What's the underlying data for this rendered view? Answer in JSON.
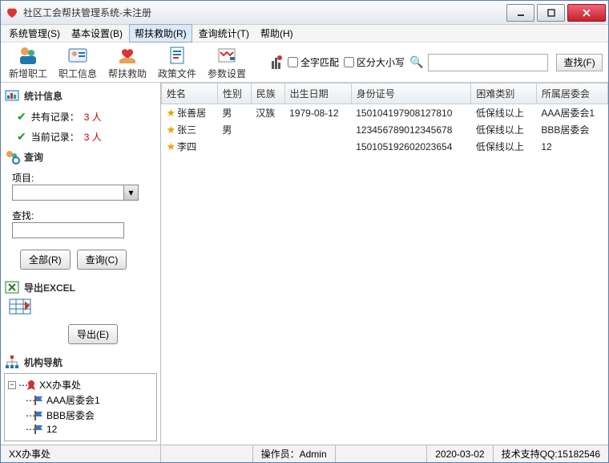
{
  "window": {
    "title": "社区工会帮扶管理系统-未注册"
  },
  "menu": {
    "items": [
      {
        "label": "系统管理(S)"
      },
      {
        "label": "基本设置(B)"
      },
      {
        "label": "帮扶救助(R)"
      },
      {
        "label": "查询统计(T)"
      },
      {
        "label": "帮助(H)"
      }
    ],
    "active_index": 2
  },
  "toolbar": {
    "buttons": [
      {
        "label": "新增职工",
        "name": "new-employee"
      },
      {
        "label": "职工信息",
        "name": "employee-info"
      },
      {
        "label": "帮扶救助",
        "name": "aid"
      },
      {
        "label": "政策文件",
        "name": "policy-docs"
      },
      {
        "label": "参数设置",
        "name": "params"
      }
    ],
    "config_icon": "wrench-icon",
    "full_match_label": "全字匹配",
    "case_sensitive_label": "区分大小写",
    "search_placeholder": "",
    "find_label": "查找(F)"
  },
  "sidebar": {
    "stats": {
      "title": "统计信息",
      "total_label": "共有记录：",
      "total_value": "3 人",
      "current_label": "当前记录：",
      "current_value": "3 人"
    },
    "query": {
      "title": "查询",
      "project_label": "项目:",
      "project_value": "",
      "search_label": "查找:",
      "search_value": "",
      "all_btn": "全部(R)",
      "query_btn": "查询(C)"
    },
    "export": {
      "title": "导出EXCEL",
      "btn": "导出(E)"
    },
    "nav": {
      "title": "机构导航",
      "root": "XX办事处",
      "children": [
        "AAA居委会1",
        "BBB居委会",
        "12"
      ]
    }
  },
  "table": {
    "columns": [
      "姓名",
      "性别",
      "民族",
      "出生日期",
      "身份证号",
      "困难类别",
      "所属居委会"
    ],
    "rows": [
      {
        "name": "张善居",
        "gender": "男",
        "ethnic": "汉族",
        "birth": "1979-08-12",
        "id": "150104197908127810",
        "category": "低保线以上",
        "committee": "AAA居委会1"
      },
      {
        "name": "张三",
        "gender": "男",
        "ethnic": "",
        "birth": "",
        "id": "123456789012345678",
        "category": "低保线以上",
        "committee": "BBB居委会"
      },
      {
        "name": "李四",
        "gender": "",
        "ethnic": "",
        "birth": "",
        "id": "150105192602023654",
        "category": "低保线以上",
        "committee": "12"
      }
    ]
  },
  "status": {
    "office": "XX办事处",
    "operator_label": "操作员：",
    "operator_value": "Admin",
    "date": "2020-03-02",
    "support": "技术支持QQ:15182546"
  }
}
